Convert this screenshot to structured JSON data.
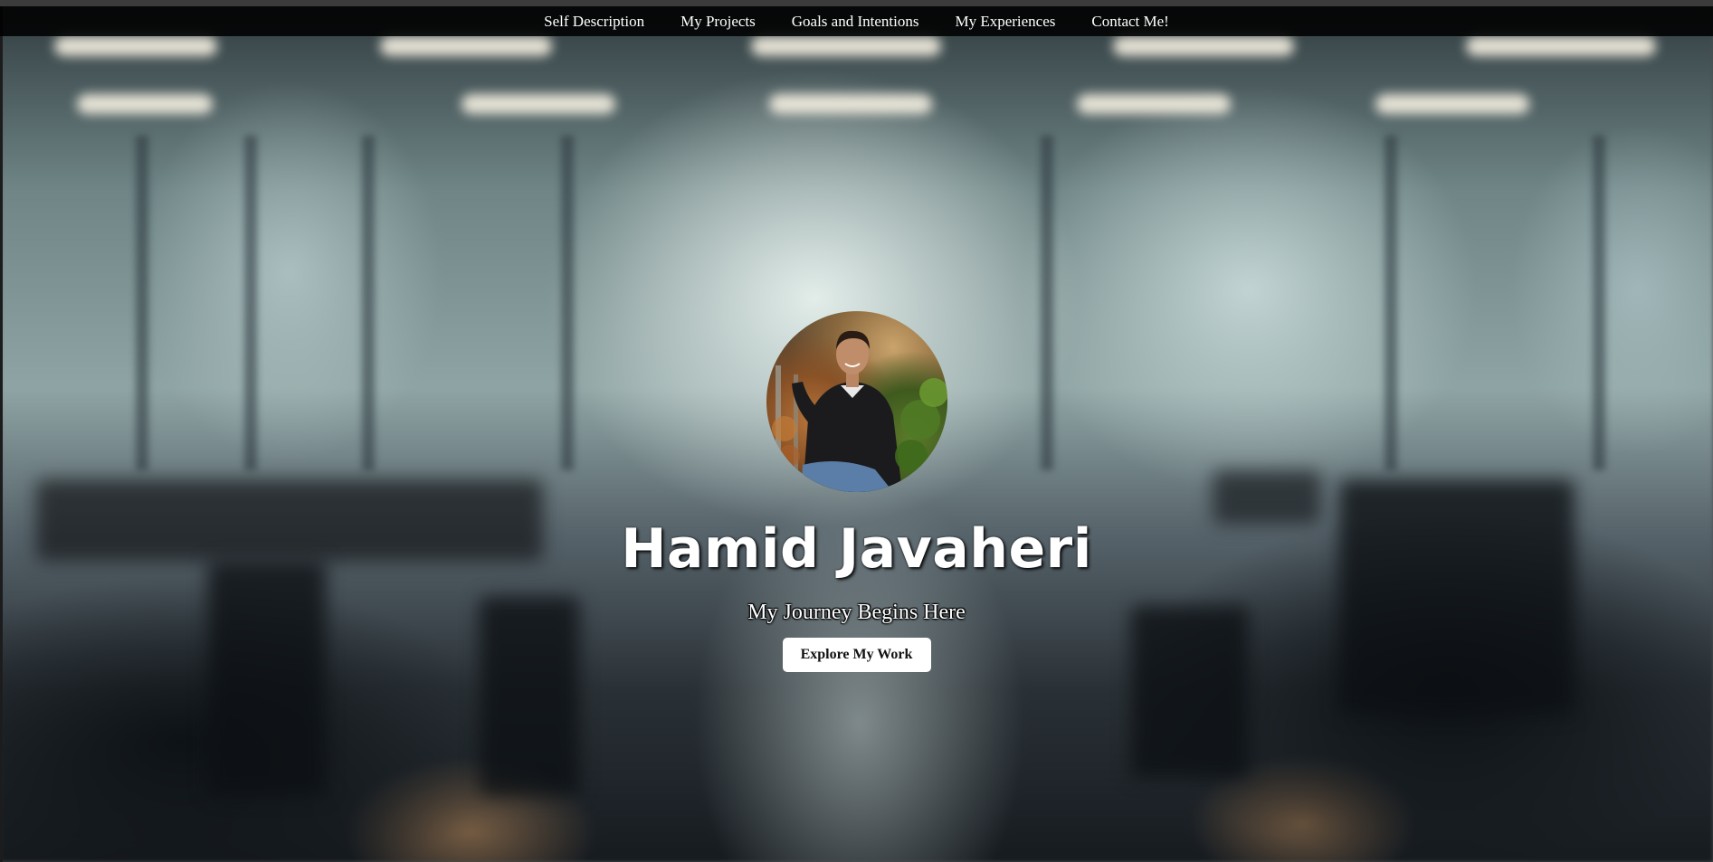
{
  "nav": {
    "items": [
      {
        "label": "Self Description"
      },
      {
        "label": "My Projects"
      },
      {
        "label": "Goals and Intentions"
      },
      {
        "label": "My Experiences"
      },
      {
        "label": "Contact Me!"
      }
    ]
  },
  "hero": {
    "name": "Hamid Javaheri",
    "tagline": "My Journey Begins Here",
    "cta_label": "Explore My Work"
  },
  "colors": {
    "nav_background": "#000000",
    "text": "#ffffff",
    "button_background": "#ffffff",
    "button_text": "#111111"
  }
}
